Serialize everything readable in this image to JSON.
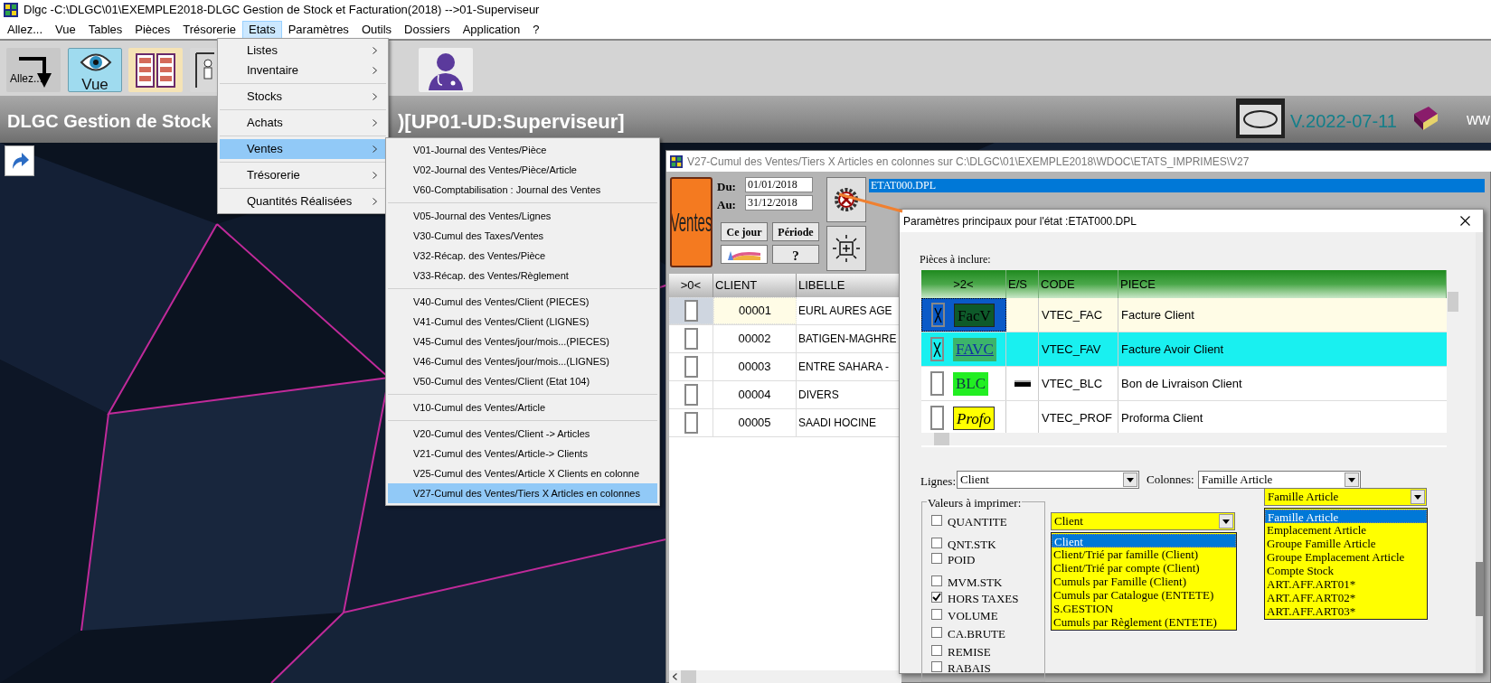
{
  "window": {
    "title": "Dlgc -C:\\DLGC\\01\\EXEMPLE2018-DLGC Gestion de Stock et Facturation(2018) -->01-Superviseur"
  },
  "menu_bar": [
    {
      "label": "Allez...",
      "selected": false
    },
    {
      "label": "Vue",
      "selected": false
    },
    {
      "label": "Tables",
      "selected": false
    },
    {
      "label": "Pièces",
      "selected": false
    },
    {
      "label": "Trésorerie",
      "selected": false
    },
    {
      "label": "Etats",
      "selected": true
    },
    {
      "label": "Paramètres",
      "selected": false
    },
    {
      "label": "Outils",
      "selected": false
    },
    {
      "label": "Dossiers",
      "selected": false
    },
    {
      "label": "Application",
      "selected": false
    },
    {
      "label": "?",
      "selected": false
    }
  ],
  "toolbar": [
    {
      "kind": "allez",
      "label": "Allez..."
    },
    {
      "kind": "vue",
      "label": "Vue"
    },
    {
      "kind": "cabinet"
    },
    {
      "kind": "person"
    },
    {
      "kind": "doctor"
    }
  ],
  "header": {
    "title_left": "DLGC Gestion de Stock",
    "title_right": ")[UP01-UD:Superviseur]",
    "version": "V.2022-07-11",
    "link": "ww"
  },
  "etats_menu": [
    {
      "label": "Listes",
      "separator_before": false,
      "selected": false
    },
    {
      "label": "Inventaire",
      "separator_before": false,
      "selected": false
    },
    {
      "label": "Stocks",
      "separator_before": true,
      "selected": false
    },
    {
      "label": "Achats",
      "separator_before": true,
      "selected": false
    },
    {
      "label": "Ventes",
      "separator_before": true,
      "selected": true
    },
    {
      "label": "Trésorerie",
      "separator_before": true,
      "selected": false
    },
    {
      "label": "Quantités Réalisées",
      "separator_before": true,
      "selected": false
    }
  ],
  "ventes_submenu": [
    {
      "label": "V01-Journal des Ventes/Pièce",
      "separator_before": false,
      "selected": false
    },
    {
      "label": "V02-Journal des Ventes/Pièce/Article",
      "separator_before": false,
      "selected": false
    },
    {
      "label": "V60-Comptabilisation : Journal des Ventes",
      "separator_before": false,
      "selected": false
    },
    {
      "label": "V05-Journal des Ventes/Lignes",
      "separator_before": true,
      "selected": false
    },
    {
      "label": "V30-Cumul des Taxes/Ventes",
      "separator_before": false,
      "selected": false
    },
    {
      "label": "V32-Récap. des Ventes/Pièce",
      "separator_before": false,
      "selected": false
    },
    {
      "label": "V33-Récap. des Ventes/Règlement",
      "separator_before": false,
      "selected": false
    },
    {
      "label": "V40-Cumul des Ventes/Client (PIECES)",
      "separator_before": true,
      "selected": false
    },
    {
      "label": "V41-Cumul des Ventes/Client (LIGNES)",
      "separator_before": false,
      "selected": false
    },
    {
      "label": "V45-Cumul des Ventes/jour/mois...(PIECES)",
      "separator_before": false,
      "selected": false
    },
    {
      "label": "V46-Cumul des Ventes/jour/mois...(LIGNES)",
      "separator_before": false,
      "selected": false
    },
    {
      "label": "V50-Cumul des Ventes/Client (Etat 104)",
      "separator_before": false,
      "selected": false
    },
    {
      "label": "V10-Cumul des Ventes/Article",
      "separator_before": true,
      "selected": false
    },
    {
      "label": "V20-Cumul des Ventes/Client -> Articles",
      "separator_before": true,
      "selected": false
    },
    {
      "label": "V21-Cumul des Ventes/Article-> Clients",
      "separator_before": false,
      "selected": false
    },
    {
      "label": "V25-Cumul des Ventes/Article X Clients en colonne",
      "separator_before": false,
      "selected": false
    },
    {
      "label": "V27-Cumul des Ventes/Tiers X Articles en colonnes",
      "separator_before": false,
      "selected": true
    }
  ],
  "report_window": {
    "title": "V27-Cumul des Ventes/Tiers X Articles en colonnes sur C:\\DLGC\\01\\EXEMPLE2018\\WDOC\\ETATS_IMPRIMES\\V27",
    "ventes_button": "Ventes",
    "du_label": "Du:",
    "du": "01/01/2018",
    "au_label": "Au:",
    "au": "31/12/2018",
    "today_button": "Ce jour",
    "period_button": "Période",
    "help_button": "?",
    "file": "ETAT000.DPL",
    "columns": [
      ">0<",
      "CLIENT",
      "LIBELLE"
    ],
    "rows": [
      {
        "selected": true,
        "checked": false,
        "client": "00001",
        "libelle": "EURL AURES AGE"
      },
      {
        "selected": false,
        "checked": false,
        "client": "00002",
        "libelle": "BATIGEN-MAGHRE"
      },
      {
        "selected": false,
        "checked": false,
        "client": "00003",
        "libelle": "ENTRE SAHARA -"
      },
      {
        "selected": false,
        "checked": false,
        "client": "00004",
        "libelle": "DIVERS"
      },
      {
        "selected": false,
        "checked": false,
        "client": "00005",
        "libelle": "SAADI HOCINE"
      }
    ]
  },
  "dialog": {
    "title": "Paramètres principaux pour l'état :ETAT000.DPL",
    "pieces_label": "Pièces à inclure:",
    "columns": [
      ">2<",
      "E/S",
      "CODE",
      "PIECE"
    ],
    "rows": [
      {
        "selected": true,
        "checked": true,
        "color": "#fffce6",
        "badge": {
          "text": "FacV",
          "kind": "dark"
        },
        "es_marker": false,
        "code": "VTEC_FAC",
        "piece": "Facture Client"
      },
      {
        "selected": false,
        "checked": true,
        "color": "#19f0f0",
        "badge": {
          "text": "FAVC",
          "kind": "link"
        },
        "es_marker": false,
        "code": "VTEC_FAV",
        "piece": "Facture Avoir Client"
      },
      {
        "selected": false,
        "checked": false,
        "color": "#ffffff",
        "badge": {
          "text": "BLC",
          "kind": "green"
        },
        "es_marker": true,
        "code": "VTEC_BLC",
        "piece": "Bon de Livraison Client"
      },
      {
        "selected": false,
        "checked": false,
        "color": "#ffffff",
        "badge": {
          "text": "Profo",
          "kind": "yellow"
        },
        "es_marker": false,
        "code": "VTEC_PROF",
        "piece": "Proforma Client"
      }
    ],
    "lignes_label": "Lignes:",
    "lignes_value": "Client",
    "colonnes_label": "Colonnes:",
    "colonnes_value": "Famille Article",
    "valeurs_label": "Valeurs à imprimer:",
    "valeurs": [
      {
        "label": "QUANTITE",
        "checked": false
      },
      {
        "label": "QNT.STK",
        "checked": false
      },
      {
        "label": "POID",
        "checked": false
      },
      {
        "label": "MVM.STK",
        "checked": false
      },
      {
        "label": "HORS TAXES",
        "checked": true
      },
      {
        "label": "VOLUME",
        "checked": false
      },
      {
        "label": "CA.BRUTE",
        "checked": false
      },
      {
        "label": "REMISE",
        "checked": false
      },
      {
        "label": "RABAIS",
        "checked": false
      }
    ],
    "lignes_combo": {
      "value": "Client",
      "options": [
        {
          "label": "Client",
          "selected": true
        },
        {
          "label": "Client/Trié par famille (Client)",
          "selected": false
        },
        {
          "label": "Client/Trié par compte (Client)",
          "selected": false
        },
        {
          "label": "Cumuls par Famille (Client)",
          "selected": false
        },
        {
          "label": "Cumuls par Catalogue (ENTETE)",
          "selected": false
        },
        {
          "label": "S.GESTION",
          "selected": false
        },
        {
          "label": "Cumuls par Règlement (ENTETE)",
          "selected": false
        }
      ]
    },
    "colonnes_combo": {
      "value": "Famille Article",
      "options": [
        {
          "label": "Famille Article",
          "selected": true
        },
        {
          "label": "Emplacement Article",
          "selected": false
        },
        {
          "label": "Groupe Famille Article",
          "selected": false
        },
        {
          "label": "Groupe Emplacement Article",
          "selected": false
        },
        {
          "label": "Compte Stock",
          "selected": false
        },
        {
          "label": "ART.AFF.ART01*",
          "selected": false
        },
        {
          "label": "ART.AFF.ART02*",
          "selected": false
        },
        {
          "label": "ART.AFF.ART03*",
          "selected": false
        }
      ]
    }
  }
}
